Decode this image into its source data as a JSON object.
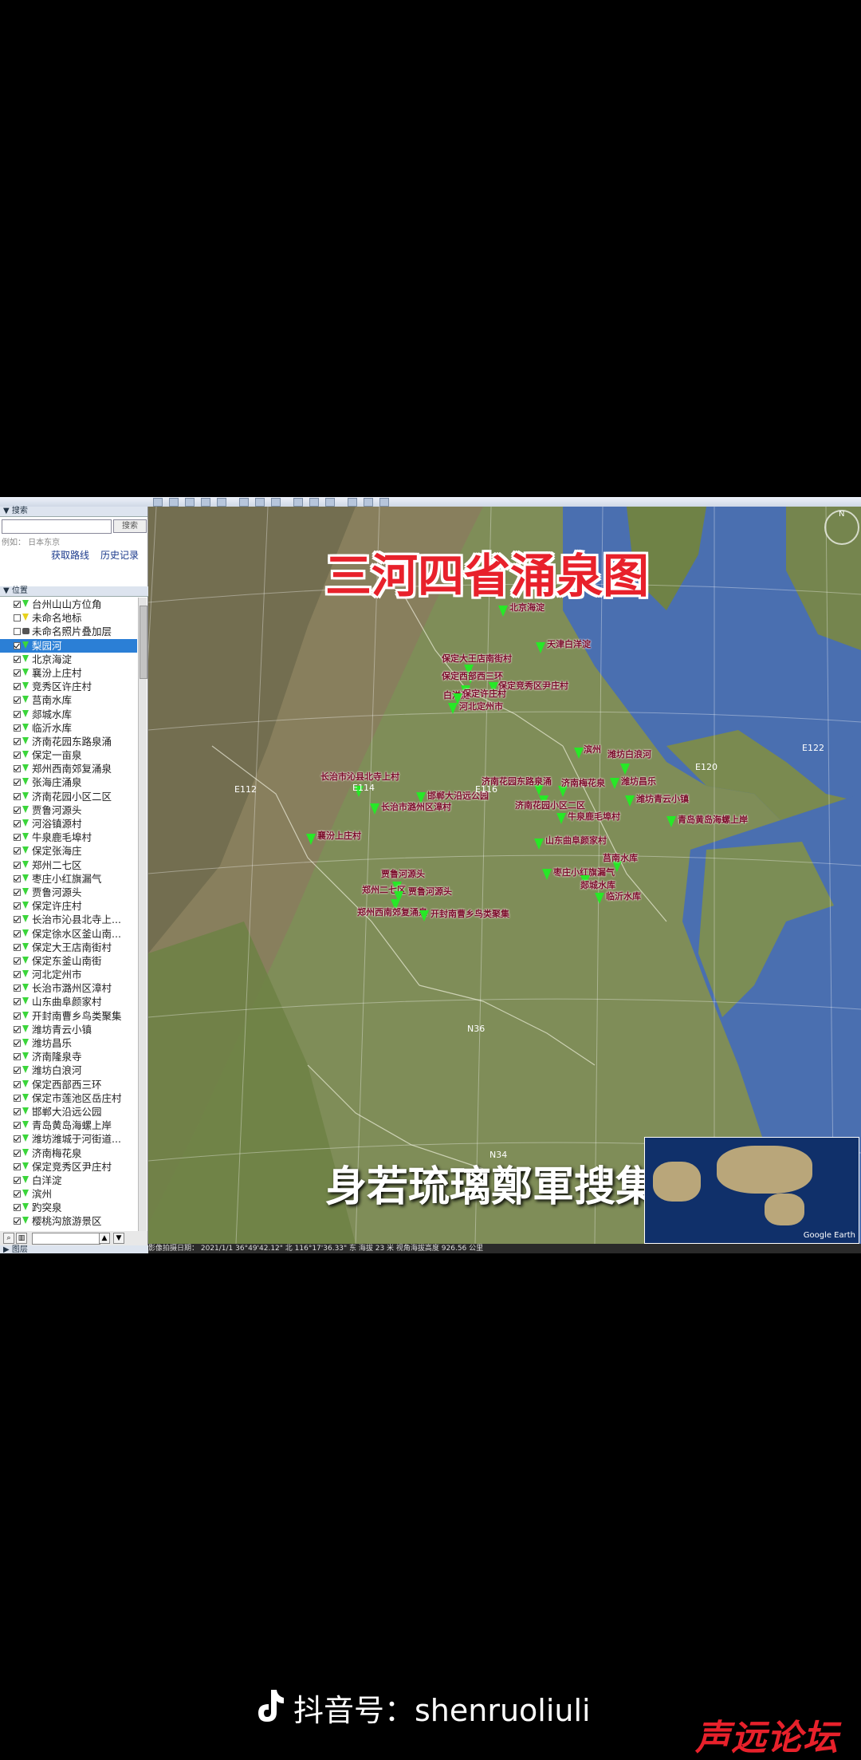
{
  "sidebar": {
    "search_header": "搜索",
    "search_button": "搜索",
    "search_hint": "例如： 日本东京",
    "get_route": "获取路线",
    "history": "历史记录",
    "places_header": "位置",
    "layers_header": "图层",
    "places": [
      {
        "label": "台州山山方位角",
        "icon": "pin",
        "checked": true
      },
      {
        "label": "未命名地标",
        "icon": "pin-yellow",
        "checked": false
      },
      {
        "label": "未命名照片叠加层",
        "icon": "camera",
        "checked": false
      },
      {
        "label": "梨园河",
        "icon": "pin",
        "checked": true,
        "selected": true
      },
      {
        "label": "北京海淀",
        "icon": "pin",
        "checked": true
      },
      {
        "label": "襄汾上庄村",
        "icon": "pin",
        "checked": true
      },
      {
        "label": "竞秀区许庄村",
        "icon": "pin",
        "checked": true
      },
      {
        "label": "莒南水库",
        "icon": "pin",
        "checked": true
      },
      {
        "label": "郯城水库",
        "icon": "pin",
        "checked": true
      },
      {
        "label": "临沂水库",
        "icon": "pin",
        "checked": true
      },
      {
        "label": "济南花园东路泉涌",
        "icon": "pin",
        "checked": true
      },
      {
        "label": "保定一亩泉",
        "icon": "pin",
        "checked": true
      },
      {
        "label": "郑州西南郊复涌泉",
        "icon": "pin",
        "checked": true
      },
      {
        "label": "张海庄涌泉",
        "icon": "pin",
        "checked": true
      },
      {
        "label": "济南花园小区二区",
        "icon": "pin",
        "checked": true
      },
      {
        "label": "贾鲁河源头",
        "icon": "pin",
        "checked": true
      },
      {
        "label": "河浴镇源村",
        "icon": "pin",
        "checked": true
      },
      {
        "label": "牛泉鹿毛埠村",
        "icon": "pin",
        "checked": true
      },
      {
        "label": "保定张海庄",
        "icon": "pin",
        "checked": true
      },
      {
        "label": "郑州二七区",
        "icon": "pin",
        "checked": true
      },
      {
        "label": "枣庄小红旗漏气",
        "icon": "pin",
        "checked": true
      },
      {
        "label": "贾鲁河源头",
        "icon": "pin",
        "checked": true
      },
      {
        "label": "保定许庄村",
        "icon": "pin",
        "checked": true
      },
      {
        "label": "长治市沁县北寺上...",
        "icon": "pin",
        "checked": true
      },
      {
        "label": "保定徐水区釜山南...",
        "icon": "pin",
        "checked": true
      },
      {
        "label": "保定大王店南街村",
        "icon": "pin",
        "checked": true
      },
      {
        "label": "保定东釜山南街",
        "icon": "pin",
        "checked": true
      },
      {
        "label": "河北定州市",
        "icon": "pin",
        "checked": true
      },
      {
        "label": "长治市潞州区漳村",
        "icon": "pin",
        "checked": true
      },
      {
        "label": "山东曲阜颜家村",
        "icon": "pin",
        "checked": true
      },
      {
        "label": "开封南曹乡鸟类聚集",
        "icon": "pin",
        "checked": true
      },
      {
        "label": "潍坊青云小镇",
        "icon": "pin",
        "checked": true
      },
      {
        "label": "潍坊昌乐",
        "icon": "pin",
        "checked": true
      },
      {
        "label": "济南隆泉寺",
        "icon": "pin",
        "checked": true
      },
      {
        "label": "潍坊白浪河",
        "icon": "pin",
        "checked": true
      },
      {
        "label": "保定西部西三环",
        "icon": "pin",
        "checked": true
      },
      {
        "label": "保定市莲池区岳庄村",
        "icon": "pin",
        "checked": true
      },
      {
        "label": "邯郸大沿远公园",
        "icon": "pin",
        "checked": true
      },
      {
        "label": "青岛黄岛海螺上岸",
        "icon": "pin",
        "checked": true
      },
      {
        "label": "潍坊潍城于河街道...",
        "icon": "pin",
        "checked": true
      },
      {
        "label": "济南梅花泉",
        "icon": "pin",
        "checked": true
      },
      {
        "label": "保定竞秀区尹庄村",
        "icon": "pin",
        "checked": true
      },
      {
        "label": "白洋淀",
        "icon": "pin",
        "checked": true
      },
      {
        "label": "滨州",
        "icon": "pin",
        "checked": true
      },
      {
        "label": "趵突泉",
        "icon": "pin",
        "checked": true
      },
      {
        "label": "樱桃沟旅游景区",
        "icon": "pin",
        "checked": true
      }
    ]
  },
  "map": {
    "title": "三河四省涌泉图",
    "subtitle": "身若琉璃鄭軍搜集標記",
    "compass_label": "N",
    "overview_logo": "Google Earth",
    "grid_labels": [
      {
        "text": "E112",
        "pos": "l1"
      },
      {
        "text": "E114",
        "pos": "l2"
      },
      {
        "text": "E116",
        "pos": "l3"
      },
      {
        "text": "E120",
        "pos": "l4"
      },
      {
        "text": "E122",
        "pos": "l5"
      },
      {
        "text": "N36",
        "pos": "l6"
      },
      {
        "text": "N34",
        "pos": "l7"
      }
    ],
    "markers": [
      {
        "label": "北京海淀",
        "pos": "m1"
      },
      {
        "label": "天津白洋淀",
        "pos": "m2"
      },
      {
        "label": "保定大王店南街村",
        "pos": "m3"
      },
      {
        "label": "保定西部西三环",
        "pos": "m4"
      },
      {
        "label": "保定竞秀区尹庄村",
        "pos": "m5"
      },
      {
        "label": "白洋淀",
        "pos": "m6"
      },
      {
        "label": "保定许庄村",
        "pos": "m7"
      },
      {
        "label": "河北定州市",
        "pos": "m8"
      },
      {
        "label": "滨州",
        "pos": "m9"
      },
      {
        "label": "潍坊白浪河",
        "pos": "m10"
      },
      {
        "label": "潍坊昌乐",
        "pos": "m11"
      },
      {
        "label": "潍坊青云小镇",
        "pos": "m12"
      },
      {
        "label": "长治市沁县北寺上村",
        "pos": "m13"
      },
      {
        "label": "邯郸大沿远公园",
        "pos": "m14"
      },
      {
        "label": "济南花园东路泉涌",
        "pos": "m15"
      },
      {
        "label": "济南梅花泉",
        "pos": "m16"
      },
      {
        "label": "济南花园小区二区",
        "pos": "m17"
      },
      {
        "label": "长治市潞州区漳村",
        "pos": "m18"
      },
      {
        "label": "牛泉鹿毛埠村",
        "pos": "m19"
      },
      {
        "label": "青岛黄岛海螺上岸",
        "pos": "m20"
      },
      {
        "label": "襄汾上庄村",
        "pos": "m21"
      },
      {
        "label": "山东曲阜颜家村",
        "pos": "m22"
      },
      {
        "label": "莒南水库",
        "pos": "m23"
      },
      {
        "label": "枣庄小红旗漏气",
        "pos": "m24"
      },
      {
        "label": "郯城水库",
        "pos": "m25"
      },
      {
        "label": "临沂水库",
        "pos": "m26"
      },
      {
        "label": "贾鲁河源头",
        "pos": "m27"
      },
      {
        "label": "郑州二七区",
        "pos": "m28"
      },
      {
        "label": "郑州西南郊复涌泉",
        "pos": "m29"
      },
      {
        "label": "贾鲁河源头",
        "pos": "m30"
      },
      {
        "label": "开封南曹乡鸟类聚集",
        "pos": "m31"
      }
    ]
  },
  "statusbar": {
    "text": "影像拍摄日期： 2021/1/1    36°49'42.12\" 北    116°17'36.33\" 东  海拔    23 米    视角海拔高度 926.56 公里"
  },
  "footer": {
    "douyin_label": "抖音号：shenruoliuli",
    "watermark": "声远论坛"
  },
  "colors": {
    "title_red": "#e8212b",
    "marker_green": "#27e827",
    "sea": "#4a6fb0",
    "land": "#7d8a55"
  }
}
